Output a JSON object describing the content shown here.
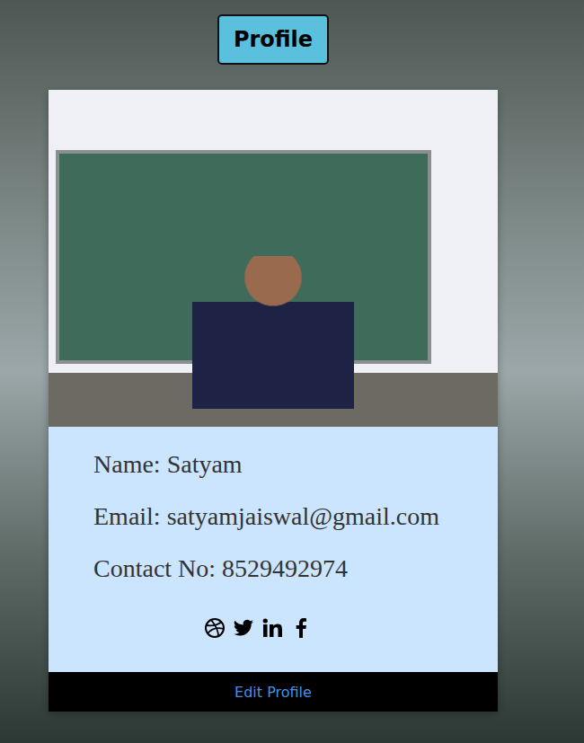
{
  "header": {
    "title": "Profile"
  },
  "card": {
    "fields": [
      {
        "label": "Name:",
        "value": "Satyam"
      },
      {
        "label": "Email:",
        "value": "satyamjaiswal@gmail.com"
      },
      {
        "label": "Contact No:",
        "value": "8529492974"
      }
    ],
    "footer_link": "Edit Profile"
  }
}
